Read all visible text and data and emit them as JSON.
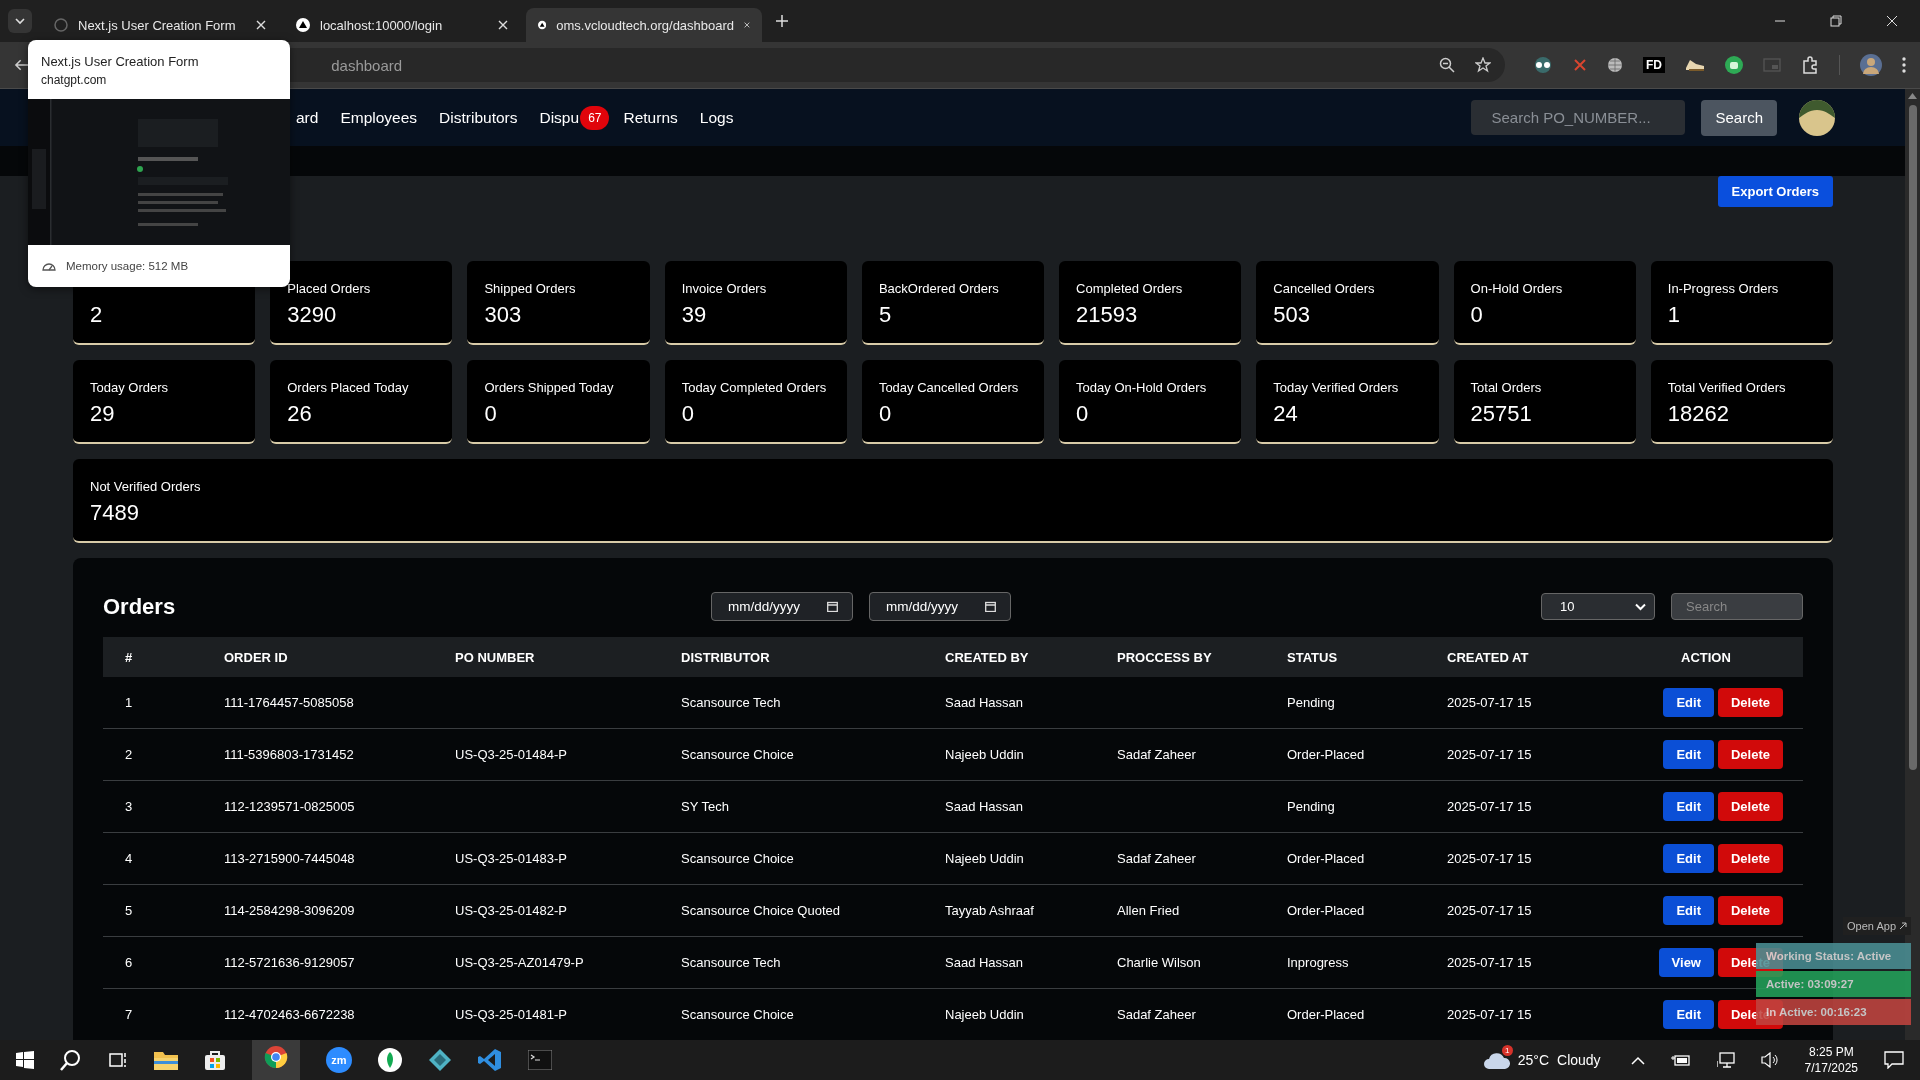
{
  "browser": {
    "tabs": [
      {
        "title": "Next.js User Creation Form",
        "selected": false
      },
      {
        "title": "localhost:10000/login",
        "selected": false
      },
      {
        "title": "oms.vcloudtech.org/dashboard",
        "selected": true
      }
    ],
    "address": "dashboard",
    "extension_label": "FD"
  },
  "tab_preview": {
    "title": "Next.js User Creation Form",
    "site": "chatgpt.com",
    "memory": "Memory usage: 512 MB"
  },
  "nav": {
    "items": [
      {
        "label": "ard"
      },
      {
        "label": "Employees"
      },
      {
        "label": "Distributors"
      },
      {
        "label": "Dispu",
        "badge": "67"
      },
      {
        "label": "Returns"
      },
      {
        "label": "Logs"
      }
    ],
    "search_placeholder": "Search PO_NUMBER...",
    "search_button": "Search"
  },
  "export_button": "Export Orders",
  "stat_rows": [
    [
      {
        "value": "2"
      },
      {
        "label": "Placed Orders",
        "value": "3290"
      },
      {
        "label": "Shipped Orders",
        "value": "303"
      },
      {
        "label": "Invoice Orders",
        "value": "39"
      },
      {
        "label": "BackOrdered Orders",
        "value": "5"
      },
      {
        "label": "Completed Orders",
        "value": "21593"
      },
      {
        "label": "Cancelled Orders",
        "value": "503"
      },
      {
        "label": "On-Hold Orders",
        "value": "0"
      },
      {
        "label": "In-Progress Orders",
        "value": "1"
      }
    ],
    [
      {
        "label": "Today Orders",
        "value": "29"
      },
      {
        "label": "Orders Placed Today",
        "value": "26"
      },
      {
        "label": "Orders Shipped Today",
        "value": "0"
      },
      {
        "label": "Today Completed Orders",
        "value": "0"
      },
      {
        "label": "Today Cancelled Orders",
        "value": "0"
      },
      {
        "label": "Today On-Hold Orders",
        "value": "0"
      },
      {
        "label": "Today Verified Orders",
        "value": "24"
      },
      {
        "label": "Total Orders",
        "value": "25751"
      },
      {
        "label": "Total Verified Orders",
        "value": "18262"
      }
    ],
    [
      {
        "label": "Not Verified Orders",
        "value": "7489"
      }
    ]
  ],
  "orders": {
    "title": "Orders",
    "date_from": "mm/dd/yyyy",
    "date_to": "mm/dd/yyyy",
    "page_size": "10",
    "search_placeholder": "Search",
    "columns": [
      "#",
      "ORDER ID",
      "PO NUMBER",
      "DISTRIBUTOR",
      "CREATED BY",
      "PROCCESS BY",
      "STATUS",
      "CREATED AT",
      "ACTION"
    ],
    "rows": [
      {
        "cells": [
          "1",
          "111-1764457-5085058",
          null,
          "Scansource Tech",
          "Saad Hassan",
          null,
          "Pending",
          "2025-07-17 15"
        ],
        "actions": [
          {
            "label": "Edit",
            "kind": "primary"
          },
          {
            "label": "Delete",
            "kind": "danger"
          }
        ]
      },
      {
        "cells": [
          "2",
          "111-5396803-1731452",
          "US-Q3-25-01484-P",
          "Scansource Choice",
          "Najeeb Uddin",
          "Sadaf Zaheer",
          "Order-Placed",
          "2025-07-17 15"
        ],
        "actions": [
          {
            "label": "Edit",
            "kind": "primary"
          },
          {
            "label": "Delete",
            "kind": "danger"
          }
        ]
      },
      {
        "cells": [
          "3",
          "112-1239571-0825005",
          null,
          "SY Tech",
          "Saad Hassan",
          null,
          "Pending",
          "2025-07-17 15"
        ],
        "actions": [
          {
            "label": "Edit",
            "kind": "primary"
          },
          {
            "label": "Delete",
            "kind": "danger"
          }
        ]
      },
      {
        "cells": [
          "4",
          "113-2715900-7445048",
          "US-Q3-25-01483-P",
          "Scansource Choice",
          "Najeeb Uddin",
          "Sadaf Zaheer",
          "Order-Placed",
          "2025-07-17 15"
        ],
        "actions": [
          {
            "label": "Edit",
            "kind": "primary"
          },
          {
            "label": "Delete",
            "kind": "danger"
          }
        ]
      },
      {
        "cells": [
          "5",
          "114-2584298-3096209",
          "US-Q3-25-01482-P",
          "Scansource Choice Quoted",
          "Tayyab Ashraaf",
          "Allen Fried",
          "Order-Placed",
          "2025-07-17 15"
        ],
        "actions": [
          {
            "label": "Edit",
            "kind": "primary"
          },
          {
            "label": "Delete",
            "kind": "danger"
          }
        ]
      },
      {
        "cells": [
          "6",
          "112-5721636-9129057",
          "US-Q3-25-AZ01479-P",
          "Scansource Tech",
          "Saad Hassan",
          "Charlie Wilson",
          "Inprogress",
          "2025-07-17 15"
        ],
        "actions": [
          {
            "label": "View",
            "kind": "primary"
          },
          {
            "label": "Delete",
            "kind": "danger"
          }
        ]
      },
      {
        "cells": [
          "7",
          "112-4702463-6672238",
          "US-Q3-25-01481-P",
          "Scansource Choice",
          "Najeeb Uddin",
          "Sadaf Zaheer",
          "Order-Placed",
          "2025-07-17 15"
        ],
        "actions": [
          {
            "label": "Edit",
            "kind": "primary"
          },
          {
            "label": "Delete",
            "kind": "danger"
          }
        ]
      }
    ]
  },
  "activity_widget": {
    "open_app": "Open App",
    "statuses": [
      {
        "text": "Working Status: Active",
        "kind": "status"
      },
      {
        "text": "Active: 03:09:27",
        "kind": "active"
      },
      {
        "text": "In Active: 00:16:23",
        "kind": "inactive"
      }
    ]
  },
  "taskbar": {
    "zoom_label": "zm",
    "weather_badge": "1",
    "temperature": "25°C",
    "condition": "Cloudy",
    "time": "8:25 PM",
    "date": "7/17/2025"
  }
}
